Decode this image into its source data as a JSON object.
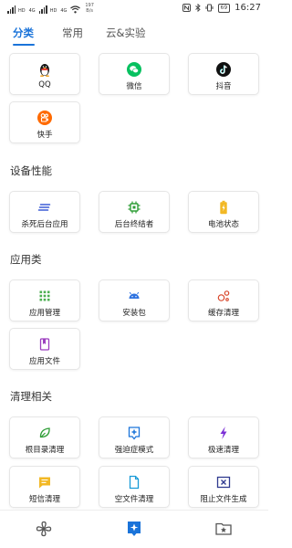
{
  "status_bar": {
    "network_labels": [
      "HD",
      "4G",
      "HD",
      "4G"
    ],
    "speed_value": "197",
    "speed_unit": "B/s",
    "battery": "69",
    "time": "16:27"
  },
  "tabs": [
    {
      "label": "分类",
      "active": true
    },
    {
      "label": "常用",
      "active": false
    },
    {
      "label": "云&实验",
      "active": false
    }
  ],
  "sections": [
    {
      "title": ""
    },
    {
      "title": "设备性能"
    },
    {
      "title": "应用类"
    },
    {
      "title": "清理相关"
    }
  ],
  "cards": {
    "qq": {
      "label": "QQ",
      "icon": "qq-penguin-icon"
    },
    "wechat": {
      "label": "微信",
      "icon": "wechat-icon",
      "color": "#07c160"
    },
    "douyin": {
      "label": "抖音",
      "icon": "douyin-icon",
      "color": "#111111"
    },
    "kuaishou": {
      "label": "快手",
      "icon": "kuaishou-icon",
      "color": "#ff6a00"
    },
    "kill_bg": {
      "label": "杀死后台应用",
      "icon": "lines-icon",
      "color": "#3b5bd6"
    },
    "bg_terminator": {
      "label": "后台终结者",
      "icon": "chip-icon",
      "color": "#2e9d36"
    },
    "battery_status": {
      "label": "电池状态",
      "icon": "battery-icon",
      "color": "#f2b824"
    },
    "app_manager": {
      "label": "应用管理",
      "icon": "grid-icon",
      "color": "#4caf50"
    },
    "install_pkg": {
      "label": "安装包",
      "icon": "android-icon",
      "color": "#2f73e0"
    },
    "cache_clean": {
      "label": "缓存清理",
      "icon": "cache-icon",
      "color": "#d9472b"
    },
    "app_files": {
      "label": "应用文件",
      "icon": "bookmark-icon",
      "color": "#9c3fbf"
    },
    "root_clean": {
      "label": "根目录清理",
      "icon": "leaf-icon",
      "color": "#2e9d36"
    },
    "ocd_mode": {
      "label": "强迫症模式",
      "icon": "plus-box-icon",
      "color": "#1a73d9"
    },
    "fast_clean": {
      "label": "极速清理",
      "icon": "bolt-icon",
      "color": "#7b2fd6"
    },
    "sms_clean": {
      "label": "短信清理",
      "icon": "message-icon",
      "color": "#f2b824"
    },
    "empty_file_clean": {
      "label": "空文件清理",
      "icon": "file-icon",
      "color": "#1a9bd7"
    },
    "block_file_gen": {
      "label": "阻止文件生成",
      "icon": "x-box-icon",
      "color": "#2f3a8f"
    }
  },
  "bottom_nav": [
    {
      "name": "fan-icon",
      "active": false
    },
    {
      "name": "star-badge-icon",
      "active": true
    },
    {
      "name": "folder-star-icon",
      "active": false
    }
  ],
  "colors": {
    "accent": "#1a73d9"
  }
}
